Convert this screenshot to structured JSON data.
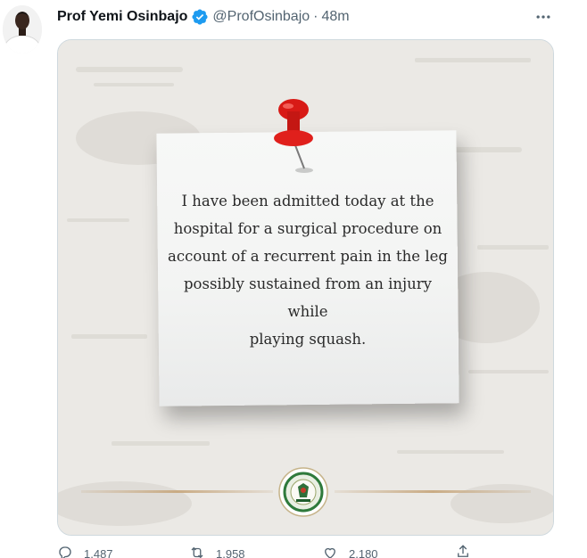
{
  "tweet": {
    "author_name": "Prof Yemi Osinbajo",
    "handle": "@ProfOsinbajo",
    "separator": "·",
    "time": "48m",
    "verified": true,
    "accent_color": "#1d9bf0"
  },
  "media": {
    "note_lines": [
      "I have been admitted today at the",
      "hospital for a surgical procedure on",
      "account of a recurrent pain in the leg",
      "possibly sustained from an injury while",
      "playing squash."
    ],
    "pin_color": "#e0201c",
    "seal_icon": "office-of-the-vice-president-seal"
  },
  "actions": {
    "reply": {
      "icon": "reply-icon",
      "count": "1,487"
    },
    "retweet": {
      "icon": "retweet-icon",
      "count": "1,958"
    },
    "like": {
      "icon": "heart-icon",
      "count": "2,180"
    },
    "share": {
      "icon": "share-icon"
    }
  }
}
